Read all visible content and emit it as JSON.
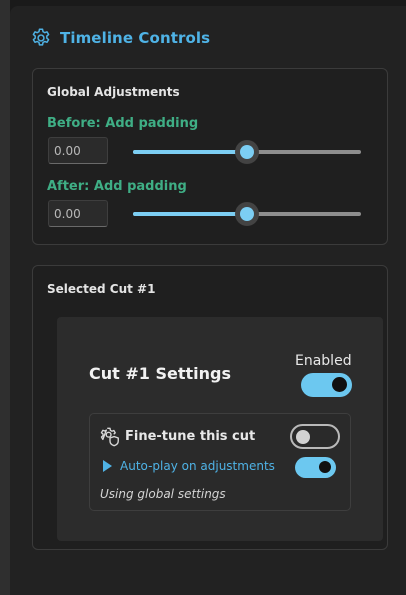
{
  "header": {
    "title": "Timeline Controls",
    "icon": "gear-icon"
  },
  "global": {
    "title": "Global Adjustments",
    "before": {
      "label": "Before: Add padding",
      "value": "0.00",
      "slider_fraction": 0.5
    },
    "after": {
      "label": "After: Add padding",
      "value": "0.00",
      "slider_fraction": 0.5
    }
  },
  "selected": {
    "title": "Selected Cut #1",
    "cut_title": "Cut #1 Settings",
    "enabled_label": "Enabled",
    "enabled": true,
    "fine_tune": {
      "label": "Fine-tune this cut",
      "on": false
    },
    "autoplay": {
      "label": "Auto-play on adjustments",
      "on": true
    },
    "status": "Using global settings"
  },
  "colors": {
    "accent": "#4fb3e6",
    "toggle_on": "#6cc8f0",
    "label_green": "#3fae85"
  }
}
